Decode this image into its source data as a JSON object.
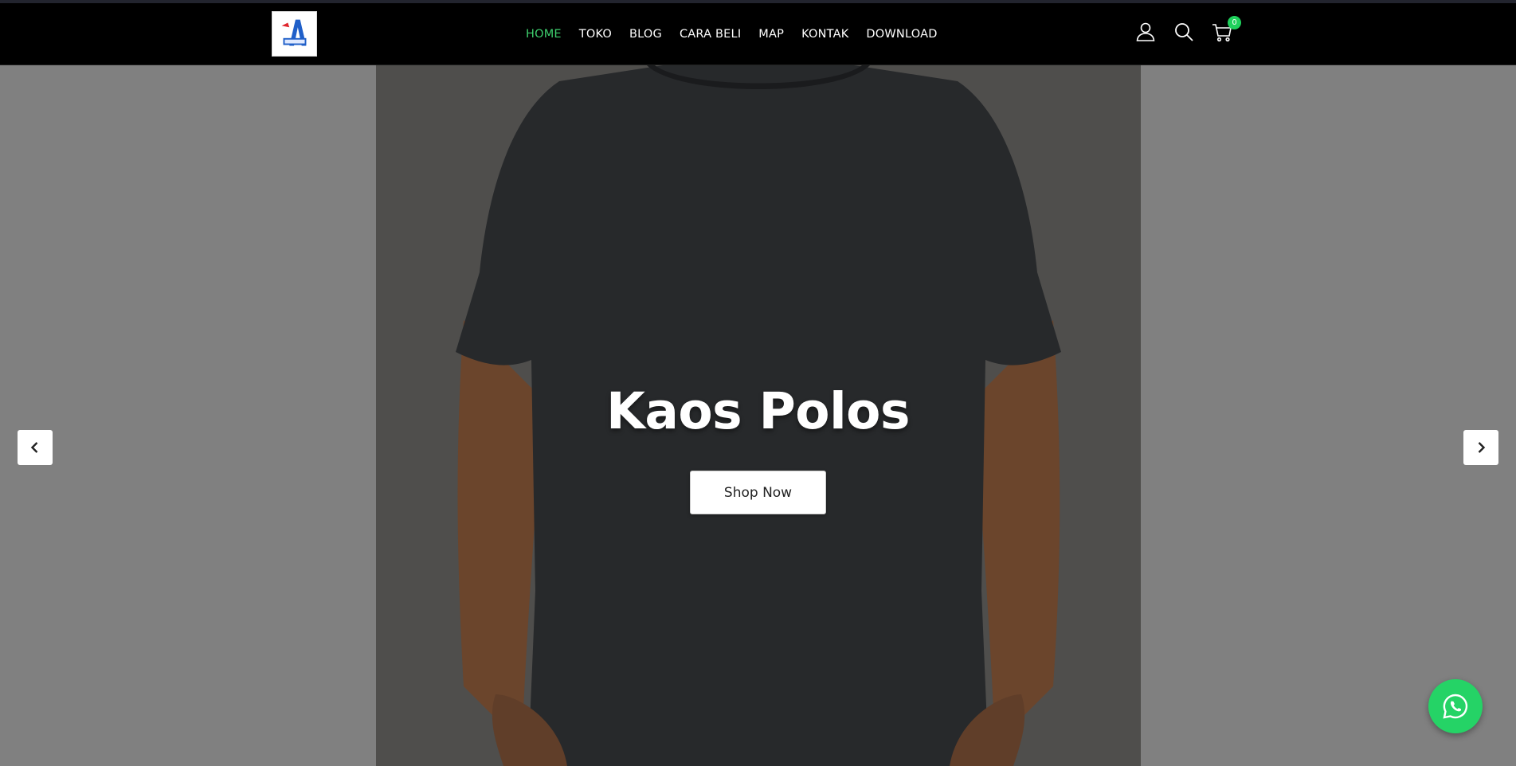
{
  "nav": {
    "items": [
      {
        "label": "HOME",
        "active": true
      },
      {
        "label": "TOKO",
        "active": false
      },
      {
        "label": "BLOG",
        "active": false
      },
      {
        "label": "CARA BELI",
        "active": false
      },
      {
        "label": "MAP",
        "active": false
      },
      {
        "label": "KONTAK",
        "active": false
      },
      {
        "label": "DOWNLOAD",
        "active": false
      }
    ],
    "cart_count": "0",
    "active_color": "#3ecf6e"
  },
  "icons": [
    "user-icon",
    "search-icon",
    "cart-icon",
    "whatsapp-icon",
    "chevron-left-icon",
    "chevron-right-icon"
  ],
  "hero": {
    "title": "Kaos Polos",
    "button_label": "Shop Now"
  },
  "colors": {
    "navbar": "#000000",
    "overlay": "#808080",
    "whatsapp": "#25d366",
    "badge": "#1fd15c"
  }
}
